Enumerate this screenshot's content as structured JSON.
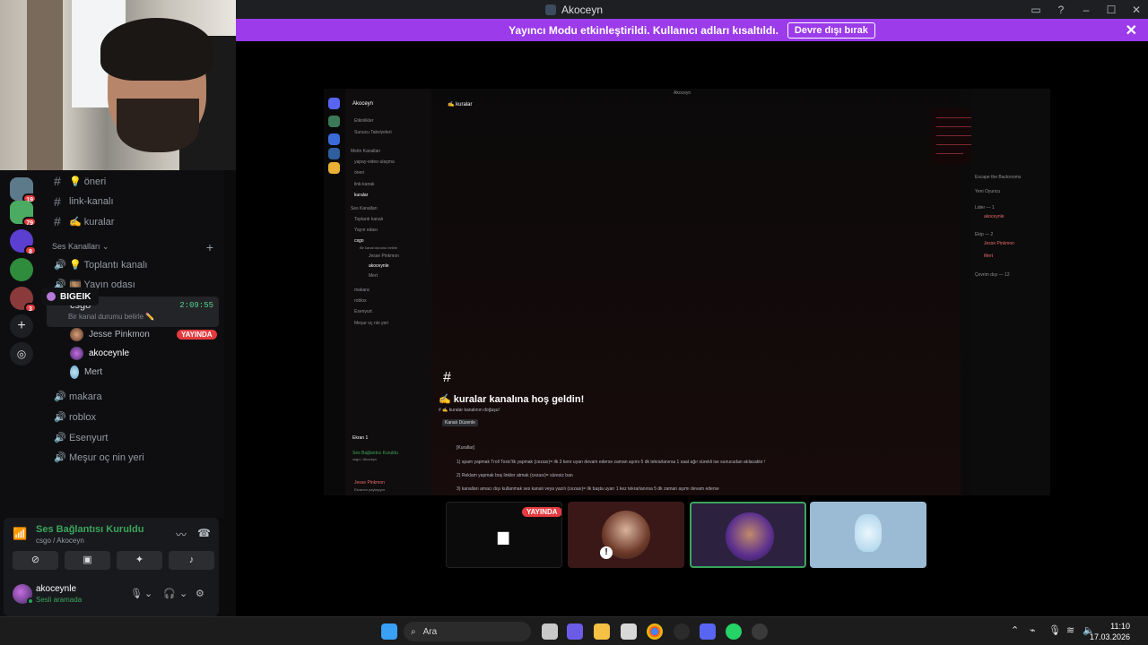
{
  "window": {
    "title": "Akoceyn",
    "controls": [
      "inbox-icon",
      "help-icon",
      "minimize-icon",
      "maximize-icon",
      "close-icon"
    ]
  },
  "banner": {
    "text": "Yayıncı Modu etkinleştirildi. Kullanıcı adları kısaltıldı.",
    "button": "Devre dışı bırak",
    "close": "✕"
  },
  "servers": [
    {
      "badge": "19",
      "color": "#5d7a8a"
    },
    {
      "badge": "79",
      "color": "#4cab62"
    },
    {
      "badge": "8",
      "color": "#5b3fd0"
    },
    {
      "badge": "",
      "color": "#2e8c3c"
    },
    {
      "badge": "3",
      "color": "#8a3a3a"
    }
  ],
  "sidebar": {
    "channels_top": [
      {
        "name": "💡 öneri"
      },
      {
        "name": "link-kanalı"
      },
      {
        "name": "✍️ kuralar"
      }
    ],
    "voice_category": "Ses Kanalları",
    "voice_channels": [
      {
        "name": "💡 Toplantı kanalı"
      },
      {
        "name": "🎞️ Yayın odası"
      }
    ],
    "tooltip": "BIGEIK",
    "active_channel": {
      "name": "csgo",
      "time": "2:09:55",
      "status": "Bir kanal durumu belirle ✏️"
    },
    "members": [
      {
        "name": "Jesse Pinkmon",
        "live": "YAYINDA"
      },
      {
        "name": "akoceynle",
        "live": ""
      },
      {
        "name": "Mert",
        "live": ""
      }
    ],
    "voice_channels_bottom": [
      {
        "name": "makara"
      },
      {
        "name": "roblox"
      },
      {
        "name": "Esenyurt"
      },
      {
        "name": "Meşur oç nin yeri"
      }
    ]
  },
  "voice_panel": {
    "title": "Ses Bağlantısı Kuruldu",
    "subtitle": "csgo / Akoceyn",
    "buttons": [
      "camera-off-icon",
      "screen-share-icon",
      "activity-icon",
      "soundboard-icon"
    ]
  },
  "user": {
    "name": "akoceynle",
    "status": "Sesli aramada"
  },
  "shared_screen": {
    "window_title": "Akoceyn",
    "server_name": "Akoceyn",
    "channel_header": "✍️ kuralar",
    "list": [
      "Etkinlikler",
      "Sunucu Takviyeleri",
      "Metin Kanalları",
      "yapay-video-ulaşma",
      "öneri",
      "link-kanalı",
      "kuralar",
      "Ses Kanalları",
      "Toplantı kanalı",
      "Yayın odası",
      "csgo",
      "Bir kanal durumu belirle",
      "Jesse Pinkmon",
      "akoceynle",
      "Mert",
      "makara",
      "roblox",
      "Esenyurt",
      "Meşur oç nin yeri"
    ],
    "welcome_title": "✍️ kuralar kanalına hoş geldin!",
    "welcome_sub": "# ✍️ kuralar kanalının doğuşu!",
    "edit_channel": "Kanalı Düzenle",
    "voice_title": "Ekran 1",
    "voice_sub1": "Ses Bağlantısı Kuruldu",
    "voice_sub2": "csgo / Akoceyn",
    "user_name": "Jesse Pinkmon",
    "user_status": "Ekranını paylaşıyor",
    "rules_header": "[Kurallar]",
    "rules": [
      "1) spam yapmak Troll Toxic'lik yapmak (cezası)= ilk 3 kere uyarı devam ederse zaman aşımı 5 dk  tekrarlanırsa 1 saat ağır sürekli ise sunucudan atılacaktır !",
      "2) Reklam yapmak boş linkler atmak (cezası)= süresiz ban",
      "3) kanalları amacı dışı kullanmak ses kanalı veya yazılı (cezası)= ilk başta uyarı 1 kez tekrarlanırsa 5 dk zaman aşımı devam ederse"
    ],
    "member_groups": [
      "Lider — 1",
      "Ekip — 2",
      "Çevrim dışı — 12"
    ],
    "members": [
      "akoceynle",
      "Jesse Pinkmon",
      "Mert"
    ],
    "activity": [
      "Escape the Backrooms",
      "Yeni Oyuncu"
    ]
  },
  "tiles": [
    {
      "live": "YAYINDA"
    }
  ],
  "taskbar": {
    "search": "Ara",
    "time": "11:10",
    "date": "17.03.2026"
  }
}
